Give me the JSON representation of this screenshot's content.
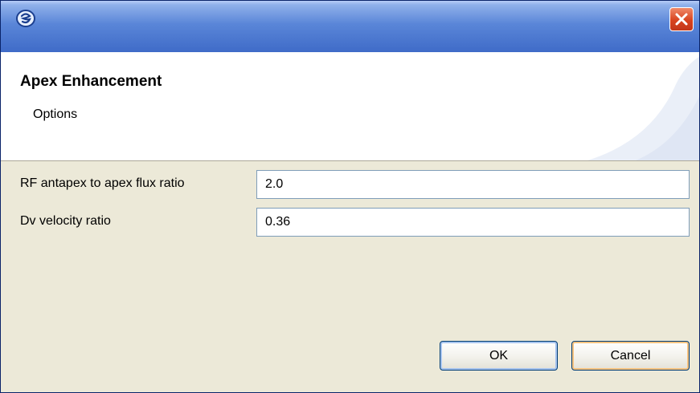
{
  "window": {
    "icon": "eclipse-app-icon",
    "close_icon": "close-icon",
    "accent_color": "#3f6bc8",
    "close_color": "#d8431f"
  },
  "banner": {
    "title": "Apex Enhancement",
    "subtitle": "Options"
  },
  "form": {
    "fields": [
      {
        "label": "RF antapex to apex flux ratio",
        "value": "2.0"
      },
      {
        "label": "Dv velocity ratio",
        "value": "0.36"
      }
    ]
  },
  "buttons": {
    "ok_label": "OK",
    "cancel_label": "Cancel"
  }
}
